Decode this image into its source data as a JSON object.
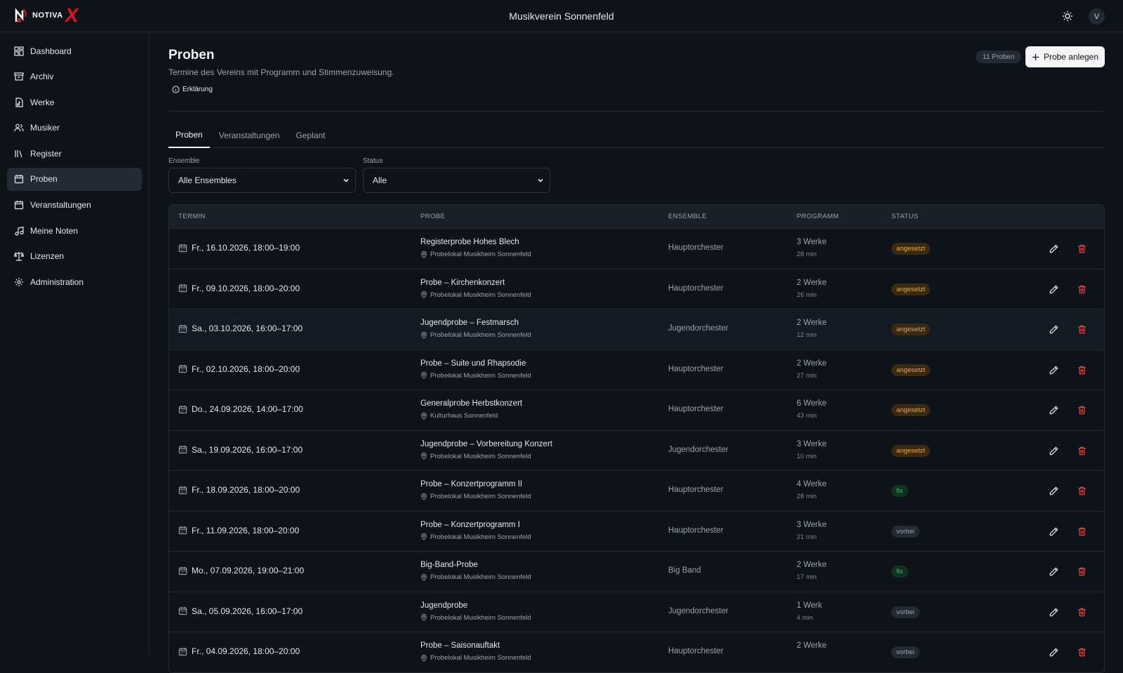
{
  "header": {
    "logo_text": "NOTIVA",
    "logo_x": "X",
    "app_title": "Musikverein Sonnenfeld",
    "avatar_initial": "V"
  },
  "sidebar": {
    "items": [
      {
        "label": "Dashboard",
        "icon": "dashboard-icon"
      },
      {
        "label": "Archiv",
        "icon": "archive-icon"
      },
      {
        "label": "Werke",
        "icon": "file-music-icon"
      },
      {
        "label": "Musiker",
        "icon": "users-icon"
      },
      {
        "label": "Register",
        "icon": "library-icon"
      },
      {
        "label": "Proben",
        "icon": "calendar-icon",
        "active": true
      },
      {
        "label": "Veranstaltungen",
        "icon": "calendar-icon"
      },
      {
        "label": "Meine Noten",
        "icon": "music-note-icon"
      },
      {
        "label": "Lizenzen",
        "icon": "scale-icon"
      },
      {
        "label": "Administration",
        "icon": "gear-icon"
      }
    ]
  },
  "page": {
    "title": "Proben",
    "description": "Termine des Vereins mit Programm und Stimmenzuweisung.",
    "explain_label": "Erklärung",
    "count_badge": "11 Proben",
    "add_button": "Probe anlegen"
  },
  "tabs": [
    {
      "label": "Proben",
      "active": true
    },
    {
      "label": "Veranstaltungen"
    },
    {
      "label": "Geplant"
    }
  ],
  "filters": {
    "ensemble": {
      "label": "Ensemble",
      "value": "Alle Ensembles"
    },
    "status": {
      "label": "Status",
      "value": "Alle"
    }
  },
  "table": {
    "headers": [
      "TERMIN",
      "PROBE",
      "ENSEMBLE",
      "PROGRAMM",
      "STATUS"
    ],
    "rows": [
      {
        "date": "Fr., 16.10.2026, 18:00–19:00",
        "title": "Registerprobe Hohes Blech",
        "location": "Probelokal Musikheim Sonnenfeld",
        "ensemble": "Hauptorchester",
        "program": "3 Werke",
        "duration": "28 min",
        "status": "angesetzt"
      },
      {
        "date": "Fr., 09.10.2026, 18:00–20:00",
        "title": "Probe – Kirchenkonzert",
        "location": "Probelokal Musikheim Sonnenfeld",
        "ensemble": "Hauptorchester",
        "program": "2 Werke",
        "duration": "26 min",
        "status": "angesetzt"
      },
      {
        "date": "Sa., 03.10.2026, 16:00–17:00",
        "title": "Jugendprobe – Festmarsch",
        "location": "Probelokal Musikheim Sonnenfeld",
        "ensemble": "Jugendorchester",
        "program": "2 Werke",
        "duration": "12 min",
        "status": "angesetzt"
      },
      {
        "date": "Fr., 02.10.2026, 18:00–20:00",
        "title": "Probe – Suite und Rhapsodie",
        "location": "Probelokal Musikheim Sonnenfeld",
        "ensemble": "Hauptorchester",
        "program": "2 Werke",
        "duration": "27 min",
        "status": "angesetzt"
      },
      {
        "date": "Do., 24.09.2026, 14:00–17:00",
        "title": "Generalprobe Herbstkonzert",
        "location": "Kulturhaus Sonnenfeld",
        "ensemble": "Hauptorchester",
        "program": "6 Werke",
        "duration": "43 min",
        "status": "angesetzt"
      },
      {
        "date": "Sa., 19.09.2026, 16:00–17:00",
        "title": "Jugendprobe – Vorbereitung Konzert",
        "location": "Probelokal Musikheim Sonnenfeld",
        "ensemble": "Jugendorchester",
        "program": "3 Werke",
        "duration": "10 min",
        "status": "angesetzt"
      },
      {
        "date": "Fr., 18.09.2026, 18:00–20:00",
        "title": "Probe – Konzertprogramm II",
        "location": "Probelokal Musikheim Sonnenfeld",
        "ensemble": "Hauptorchester",
        "program": "4 Werke",
        "duration": "28 min",
        "status": "fix"
      },
      {
        "date": "Fr., 11.09.2026, 18:00–20:00",
        "title": "Probe – Konzertprogramm I",
        "location": "Probelokal Musikheim Sonnenfeld",
        "ensemble": "Hauptorchester",
        "program": "3 Werke",
        "duration": "21 min",
        "status": "vorbei"
      },
      {
        "date": "Mo., 07.09.2026, 19:00–21:00",
        "title": "Big-Band-Probe",
        "location": "Probelokal Musikheim Sonnenfeld",
        "ensemble": "Big Band",
        "program": "2 Werke",
        "duration": "17 min",
        "status": "fix"
      },
      {
        "date": "Sa., 05.09.2026, 16:00–17:00",
        "title": "Jugendprobe",
        "location": "Probelokal Musikheim Sonnenfeld",
        "ensemble": "Jugendorchester",
        "program": "1 Werk",
        "duration": "4 min",
        "status": "vorbei"
      },
      {
        "date": "Fr., 04.09.2026, 18:00–20:00",
        "title": "Probe – Saisonauftakt",
        "location": "Probelokal Musikheim Sonnenfeld",
        "ensemble": "Hauptorchester",
        "program": "2 Werke",
        "duration": "",
        "status": "vorbei"
      }
    ]
  },
  "colors": {
    "background": "#0e131a",
    "accent_red": "#e0151b",
    "status_angesetzt": "#e2a847",
    "status_fix": "#36b46a",
    "delete": "#e0454a"
  }
}
